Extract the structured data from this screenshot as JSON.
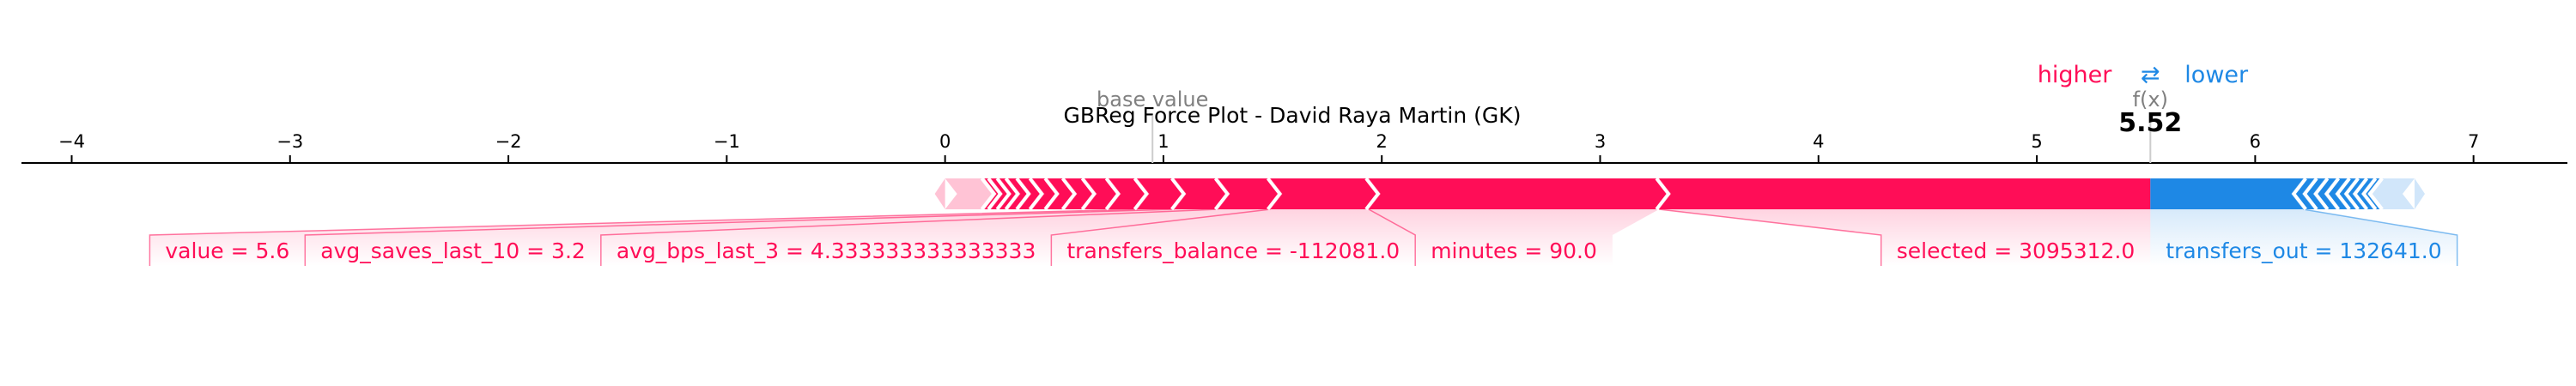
{
  "chart_data": {
    "type": "force",
    "title": "GBReg Force Plot - David Raya Martin (GK)",
    "base_value_label": "base value",
    "fx_label": "f(x)",
    "base_value": 0.95,
    "output_value": 5.52,
    "output_value_text": "5.52",
    "legend": {
      "higher": "higher",
      "lower": "lower",
      "arrow": "⇄"
    },
    "xlim": [
      -4.23,
      7.43
    ],
    "ticks": [
      -4,
      -3,
      -2,
      -1,
      0,
      1,
      2,
      3,
      4,
      5,
      6,
      7
    ],
    "tick_labels": [
      "−4",
      "−3",
      "−2",
      "−1",
      "0",
      "1",
      "2",
      "3",
      "4",
      "5",
      "6",
      "7"
    ],
    "features": [
      {
        "label": "selected = 3095312.0",
        "effect": 2.25,
        "direction": "positive"
      },
      {
        "label": "minutes = 90.0",
        "effect": 1.33,
        "direction": "positive"
      },
      {
        "label": "transfers_balance = -112081.0",
        "effect": 0.45,
        "direction": "positive"
      },
      {
        "label": "avg_bps_last_3 = 4.333333333333333",
        "effect": 0.24,
        "direction": "positive"
      },
      {
        "label": "avg_saves_last_10 = 3.2",
        "effect": 0.2,
        "direction": "positive"
      },
      {
        "label": "value = 5.6",
        "effect": 0.17,
        "direction": "positive"
      },
      {
        "label": "",
        "effect": 0.13,
        "direction": "positive"
      },
      {
        "label": "",
        "effect": 0.11,
        "direction": "positive"
      },
      {
        "label": "",
        "effect": 0.09,
        "direction": "positive"
      },
      {
        "label": "",
        "effect": 0.08,
        "direction": "positive"
      },
      {
        "label": "",
        "effect": 0.07,
        "direction": "positive"
      },
      {
        "label": "",
        "effect": 0.06,
        "direction": "positive"
      },
      {
        "label": "",
        "effect": 0.05,
        "direction": "positive"
      },
      {
        "label": "",
        "effect": 0.04,
        "direction": "positive"
      },
      {
        "label": "",
        "effect": 0.04,
        "direction": "positive"
      },
      {
        "label": "",
        "effect": 0.03,
        "direction": "positive"
      },
      {
        "label": "",
        "effect": 0.18,
        "direction": "positive"
      },
      {
        "label": "transfers_out = 132641.0",
        "effect": -0.7,
        "direction": "negative"
      },
      {
        "label": "",
        "effect": -0.05,
        "direction": "negative"
      },
      {
        "label": "",
        "effect": -0.05,
        "direction": "negative"
      },
      {
        "label": "",
        "effect": -0.05,
        "direction": "negative"
      },
      {
        "label": "",
        "effect": -0.05,
        "direction": "negative"
      },
      {
        "label": "",
        "effect": -0.04,
        "direction": "negative"
      },
      {
        "label": "",
        "effect": -0.04,
        "direction": "negative"
      },
      {
        "label": "",
        "effect": -0.04,
        "direction": "negative"
      },
      {
        "label": "",
        "effect": -0.03,
        "direction": "negative"
      },
      {
        "label": "",
        "effect": -0.16,
        "direction": "negative"
      }
    ],
    "colors": {
      "positive": "#ff0d57",
      "negative": "#1e88e5",
      "positive_light": "#ffc3d5",
      "negative_light": "#d1e6fa",
      "axis": "#000000",
      "muted_text": "#808080"
    }
  }
}
